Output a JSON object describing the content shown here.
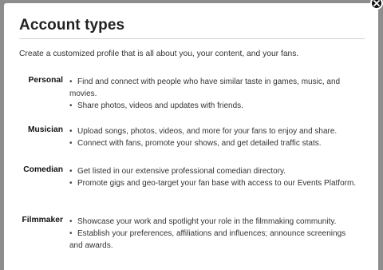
{
  "dialog": {
    "title": "Account types",
    "intro": "Create a customized profile that is all about you, your content, and your fans.",
    "close_icon": "close-icon",
    "types": [
      {
        "name": "Personal",
        "bullets": [
          "Find and connect with people who have similar taste in games, music, and movies.",
          "Share photos, videos and updates with friends."
        ]
      },
      {
        "name": "Musician",
        "bullets": [
          "Upload songs, photos, videos, and more for your fans to enjoy and share.",
          "Connect with fans, promote your shows, and get detailed traffic stats."
        ]
      },
      {
        "name": "Comedian",
        "bullets": [
          "Get listed in our extensive professional comedian directory.",
          "Promote gigs and geo-target your fan base with access to our Events Platform."
        ]
      },
      {
        "name": "Filmmaker",
        "bullets": [
          "Showcase your work and spotlight your role in the filmmaking community.",
          "Establish your preferences, affiliations and influences; announce screenings and awards."
        ]
      }
    ]
  }
}
